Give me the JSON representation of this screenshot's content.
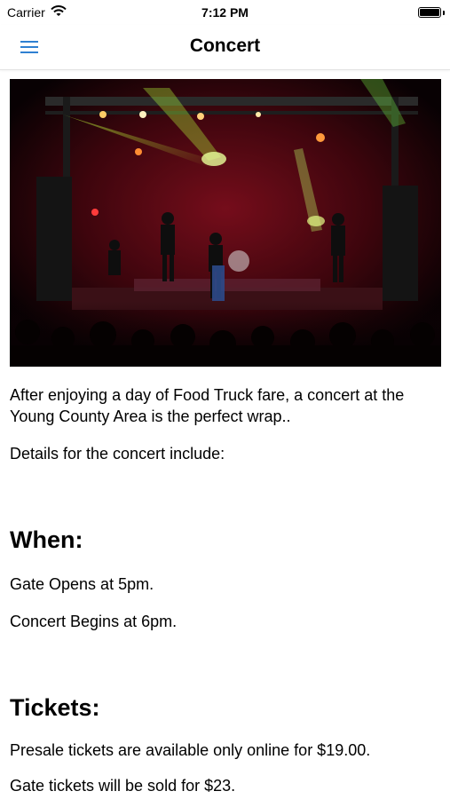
{
  "status_bar": {
    "carrier": "Carrier",
    "time": "7:12 PM",
    "wifi_icon": "wifi-icon",
    "battery_icon": "battery-icon"
  },
  "nav": {
    "title": "Concert",
    "menu_icon": "hamburger-menu-icon",
    "accent_color": "#2f80d1"
  },
  "content": {
    "hero_image": "concert-stage-photo",
    "intro": "After enjoying a day of Food Truck fare, a concert at the Young County Area is the perfect wrap..",
    "details_intro": "Details for the concert include:",
    "when_heading": "When:",
    "gate_opens": "Gate Opens at 5pm.",
    "concert_begins": "Concert Begins at 6pm.",
    "tickets_heading": "Tickets:",
    "presale": "Presale tickets are available only online for $19.00.",
    "gate_tickets": "Gate tickets will be sold for $23."
  }
}
